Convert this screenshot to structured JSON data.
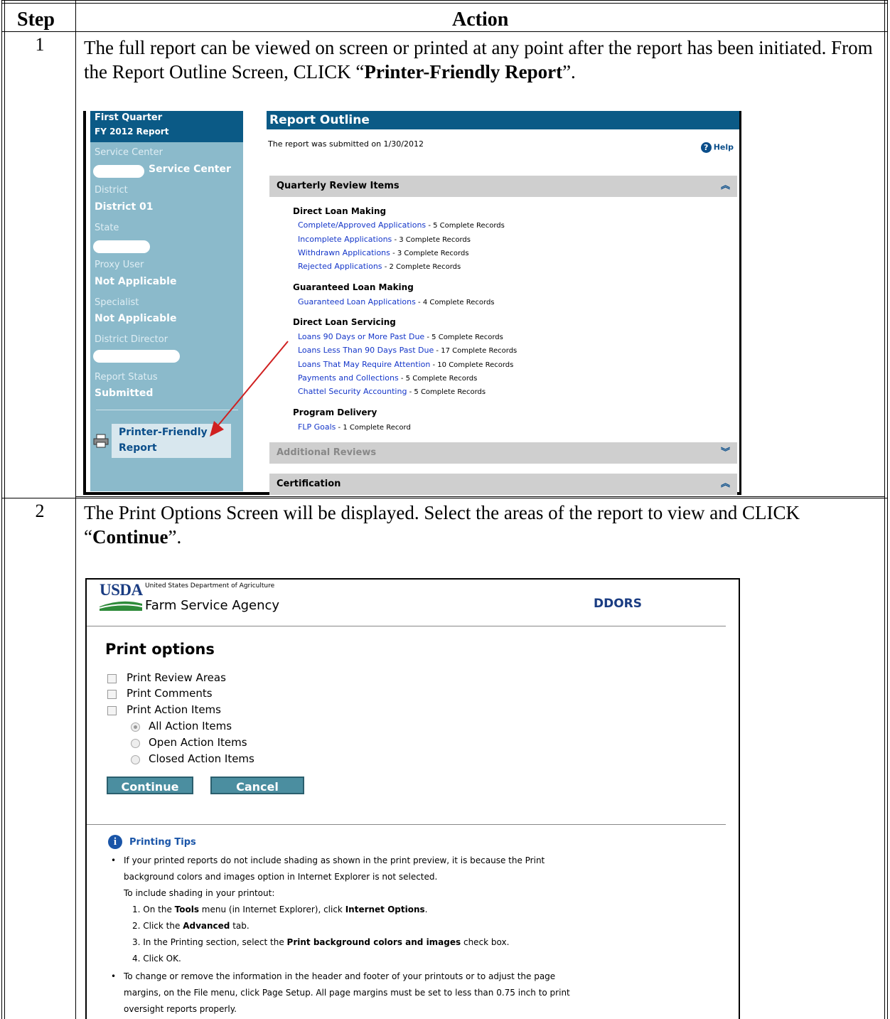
{
  "table": {
    "col_step": "Step",
    "col_action": "Action"
  },
  "steps": [
    {
      "number": "1",
      "text_before": "The full report can be viewed on screen or printed at any point after the report has been initiated.  From the Report Outline Screen, CLICK “",
      "bold": "Printer-Friendly Report",
      "text_after": "”."
    },
    {
      "number": "2",
      "text_before": "The Print Options Screen will be displayed.  Select the areas of the report to view and CLICK “",
      "bold": "Continue",
      "text_after": "”."
    }
  ],
  "report_outline": {
    "sidebar": {
      "title_line1": "First Quarter",
      "title_line2": "FY 2012 Report",
      "service_center_label": "Service Center",
      "service_center_value": "Service Center",
      "district_label": "District",
      "district_value": "District 01",
      "state_label": "State",
      "proxy_label": "Proxy User",
      "proxy_value": "Not Applicable",
      "specialist_label": "Specialist",
      "specialist_value": "Not Applicable",
      "director_label": "District Director",
      "status_label": "Report Status",
      "status_value": "Submitted",
      "printer_line1": "Printer-Friendly",
      "printer_line2": "Report"
    },
    "title": "Report Outline",
    "submitted_text": "The report was submitted on 1/30/2012",
    "help_label": "Help",
    "sections": {
      "quarterly": "Quarterly Review Items",
      "additional": "Additional Reviews",
      "certification": "Certification"
    },
    "groups": [
      {
        "name": "Direct Loan Making",
        "items": [
          {
            "link": "Complete/Approved Applications",
            "records": " - 5 Complete Records"
          },
          {
            "link": "Incomplete Applications",
            "records": " - 3 Complete Records"
          },
          {
            "link": "Withdrawn Applications",
            "records": " - 3 Complete Records"
          },
          {
            "link": "Rejected Applications",
            "records": " - 2 Complete Records"
          }
        ]
      },
      {
        "name": "Guaranteed Loan Making",
        "items": [
          {
            "link": "Guaranteed Loan Applications",
            "records": " - 4 Complete Records"
          }
        ]
      },
      {
        "name": "Direct Loan Servicing",
        "items": [
          {
            "link": "Loans 90 Days or More Past Due",
            "records": " - 5 Complete Records"
          },
          {
            "link": "Loans Less Than 90 Days Past Due",
            "records": " - 17 Complete Records"
          },
          {
            "link": "Loans That May Require Attention",
            "records": " - 10 Complete Records"
          },
          {
            "link": "Payments and Collections",
            "records": " - 5 Complete Records"
          },
          {
            "link": "Chattel Security Accounting",
            "records": " - 5 Complete Records"
          }
        ]
      },
      {
        "name": "Program Delivery",
        "items": [
          {
            "link": "FLP Goals",
            "records": " - 1 Complete Record"
          }
        ]
      }
    ]
  },
  "print_options": {
    "usda": "USDA",
    "dept": "United States Department of Agriculture",
    "agency": "Farm Service Agency",
    "app": "DDORS",
    "title": "Print options",
    "checkboxes": [
      "Print Review Areas",
      "Print Comments",
      "Print Action Items"
    ],
    "radios": [
      "All Action Items",
      "Open Action Items",
      "Closed Action Items"
    ],
    "continue": "Continue",
    "cancel": "Cancel",
    "tips_title": "Printing Tips",
    "tip1_line1": "If your printed reports do not include shading as shown in the print preview, it is because the Print",
    "tip1_line2": "background colors and images option in Internet Explorer is not selected.",
    "tip1_line3": "To include shading in your printout:",
    "steps": {
      "s1_a": "1.  On the ",
      "s1_b": "Tools",
      "s1_c": " menu (in Internet Explorer), click ",
      "s1_d": "Internet Options",
      "s1_e": ".",
      "s2_a": "2.  Click the ",
      "s2_b": "Advanced",
      "s2_c": " tab.",
      "s3_a": "3.  In the Printing section, select the ",
      "s3_b": "Print background colors and images",
      "s3_c": " check box.",
      "s4": "4.  Click OK."
    },
    "tip2_line1": "To change or remove the information in the header and footer of your printouts or to adjust the page",
    "tip2_line2": "margins, on the File menu, click Page Setup. All page margins must be set to less than 0.75 inch to print",
    "tip2_line3": "oversight reports properly."
  }
}
